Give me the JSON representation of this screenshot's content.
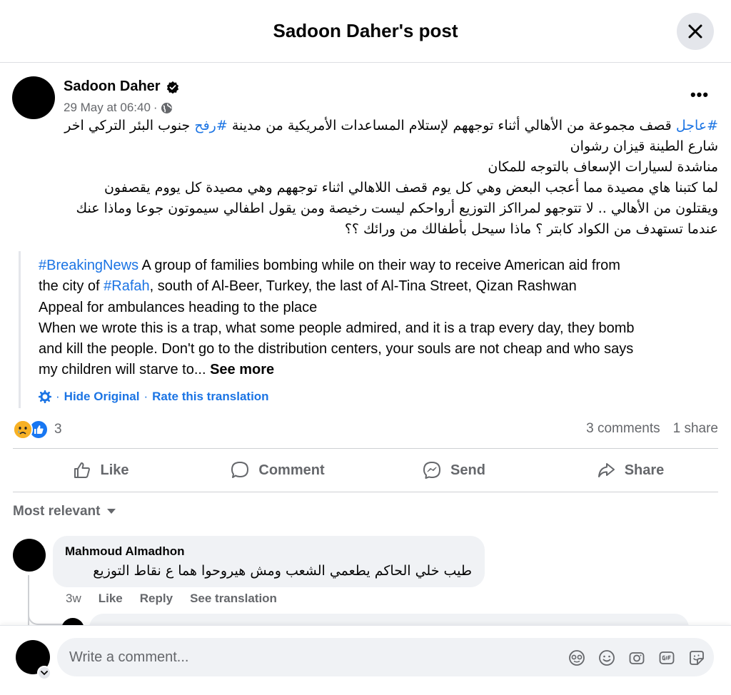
{
  "header": {
    "title": "Sadoon Daher's post"
  },
  "post": {
    "author": "Sadoon Daher",
    "timestamp": "29 May at 06:40",
    "meta_sep": "·",
    "more_label": "•••",
    "arabic_lines": [
      {
        "hashtag": "#عاجل",
        "text": " قصف مجموعة من الأهالي أثناء توجههم لإستلام المساعدات الأمريكية من مدينة ",
        "hashtag2": "#رفح",
        "text2": " جنوب البئر التركي اخر"
      },
      {
        "text": "شارع الطينة قيزان رشوان"
      },
      {
        "text": "مناشدة لسيارات الإسعاف بالتوجه للمكان"
      },
      {
        "text": "لما كتبنا هاي مصيدة مما أعجب البعض وهي كل يوم قصف اللاهالي اثناء توجههم وهي مصيدة كل يووم يقصفون"
      },
      {
        "text": "ويقتلون من الأهالي .. لا تتوجهو لمرااكز التوزيع أرواحكم ليست رخيصة ومن يقول اطفالي سيموتون جوعا وماذا عنك"
      },
      {
        "text": "عندما تستهدف من الكواد كابتر ؟ ماذا سيحل بأطفالك من ورائك ؟؟"
      }
    ],
    "translation": {
      "hashtag1": "#BreakingNews",
      "line1_rest": " A group of families bombing while on their way to receive American aid from",
      "line2_pre": "the city of ",
      "hashtag2": "#Rafah",
      "line2_rest": ", south of Al-Beer, Turkey, the last of Al-Tina Street, Qizan Rashwan",
      "line3": "Appeal for ambulances heading to the place",
      "line4": "When we wrote this is a trap, what some people admired, and it is a trap every day, they bomb",
      "line5": "and kill the people. Don't go to the distribution centers, your souls are not cheap and who says",
      "line6": "my children will starve to... ",
      "see_more": "See more",
      "hide_original": "Hide Original",
      "sep": "·",
      "rate": "Rate this translation"
    },
    "reactions_count": "3",
    "comments_count": "3 comments",
    "shares_count": "1 share"
  },
  "actions": {
    "like": "Like",
    "comment": "Comment",
    "send": "Send",
    "share": "Share"
  },
  "comments": {
    "sort_label": "Most relevant",
    "items": [
      {
        "author": "Mahmoud Almadhon",
        "text": "طيب خلي الحاكم يطعمي الشعب ومش هيروحوا هما ع نقاط التوزيع",
        "age": "3w",
        "like": "Like",
        "reply": "Reply",
        "see_translation": "See translation"
      }
    ]
  },
  "composer": {
    "placeholder": "Write a comment..."
  },
  "colors": {
    "accent": "#1b74e4",
    "secondary_text": "#65676b",
    "bubble_bg": "#f0f2f5"
  }
}
